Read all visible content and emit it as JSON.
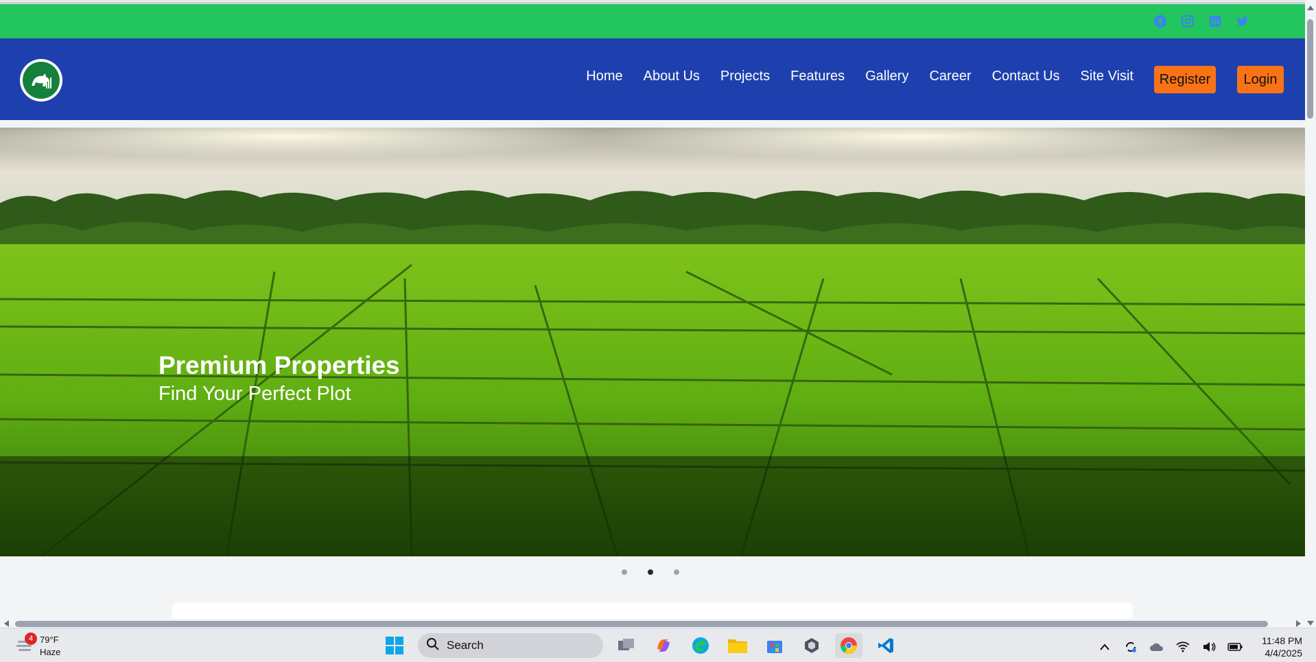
{
  "social": {
    "icons": [
      "facebook-icon",
      "instagram-icon",
      "linkedin-icon",
      "twitter-icon"
    ],
    "icon_color": "#3b82f6"
  },
  "nav": {
    "links": [
      "Home",
      "About Us",
      "Projects",
      "Features",
      "Gallery",
      "Career",
      "Contact Us",
      "Site Visit"
    ],
    "register_label": "Register",
    "login_label": "Login"
  },
  "hero": {
    "title": "Premium Properties",
    "subtitle": "Find Your Perfect Plot",
    "slide_count": 3,
    "active_slide": 2
  },
  "taskbar": {
    "weather_temp": "79°F",
    "weather_desc": "Haze",
    "weather_badge": "4",
    "search_label": "Search",
    "time": "11:48 PM",
    "date": "4/4/2025"
  },
  "colors": {
    "social_bar": "#22c55e",
    "navbar": "#1e40af",
    "button": "#f97316"
  }
}
